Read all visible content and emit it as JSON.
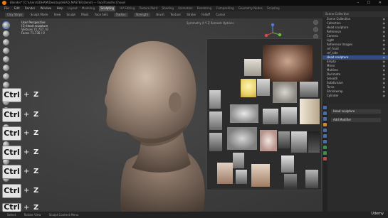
{
  "titlebar": {
    "text": "Blender* [C:\\Users\\EDHAM\\Desktop\\HEAD_MASTER.blend] — FaceTransfer.Choxel",
    "controls": "– ☐ ✕"
  },
  "menubar": {
    "menus": [
      "File",
      "Edit",
      "Render",
      "Window",
      "Help"
    ],
    "workspaces": [
      "Layout",
      "Modeling",
      "Sculpting",
      "UV Editing",
      "Texture Paint",
      "Shading",
      "Animation",
      "Rendering",
      "Compositing",
      "Geometry Nodes",
      "Scripting"
    ],
    "active_workspace": "Sculpting"
  },
  "toolheader": {
    "items": [
      "Sculpt Mode",
      "View",
      "Sculpt",
      "Mask",
      "Face Sets"
    ],
    "brush": "Clay Strips",
    "options": [
      "Radius",
      "Strength",
      "Brush",
      "Texture",
      "Stroke",
      "Falloff",
      "Cursor"
    ]
  },
  "viewport": {
    "perspective": "User Perspective",
    "object": "(1) Head sculpture",
    "stats": [
      {
        "label": "Vertices",
        "value": "71,737 / 0"
      },
      {
        "label": "Faces",
        "value": "71,736 / 0"
      }
    ],
    "header_right": [
      "Symmetry",
      "X Y Z",
      "Remesh",
      "Options"
    ]
  },
  "overlay": {
    "ctrl_label": "Ctrl",
    "plus": "+",
    "z_label": "Z",
    "count": 7
  },
  "outliner": {
    "header": "Scene Collection",
    "rows": [
      {
        "label": "Scene Collection",
        "selected": false
      },
      {
        "label": "Collection",
        "selected": false
      },
      {
        "label": "Head sculpture",
        "selected": false
      },
      {
        "label": "Reference",
        "selected": false
      },
      {
        "label": "Camera",
        "selected": false
      },
      {
        "label": "Light",
        "selected": false
      },
      {
        "label": "Reference Images",
        "selected": false
      },
      {
        "label": "ref_front",
        "selected": false
      },
      {
        "label": "ref_side",
        "selected": false
      },
      {
        "label": "Head sculpture",
        "selected": true
      },
      {
        "label": "Empty",
        "selected": false
      },
      {
        "label": "Mirror",
        "selected": false
      },
      {
        "label": "Multires",
        "selected": false
      },
      {
        "label": "Decimate",
        "selected": false
      },
      {
        "label": "Smooth",
        "selected": false
      },
      {
        "label": "Subdivision",
        "selected": false
      },
      {
        "label": "Torso",
        "selected": false
      },
      {
        "label": "Shrinkwrap",
        "selected": false
      },
      {
        "label": "Cylinder",
        "selected": false
      }
    ]
  },
  "properties": {
    "object_field": "Head sculpture",
    "add_modifier": "Add Modifier"
  },
  "statusbar": {
    "items": [
      "Select",
      "Rotate View",
      "Sculpt Context Menu"
    ]
  },
  "watermark": "Udemy"
}
